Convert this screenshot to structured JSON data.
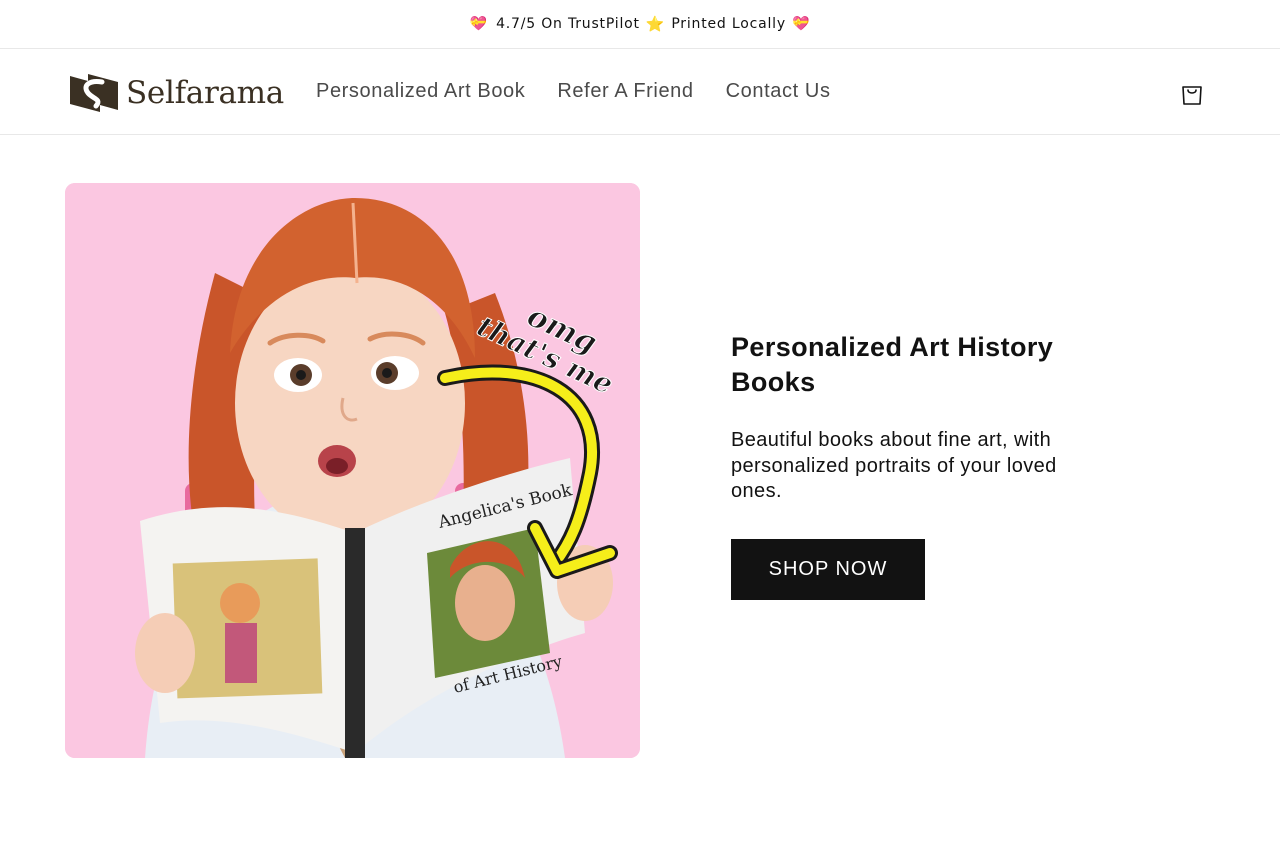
{
  "announcement": {
    "rating_text": "4.7/5 On TrustPilot",
    "printed_text": "Printed Locally",
    "heart_glyph": "💝",
    "star_glyph": "⭐"
  },
  "brand": {
    "name": "Selfarama",
    "logo_color": "#3a3023"
  },
  "nav": {
    "items": [
      {
        "label": "Personalized Art Book"
      },
      {
        "label": "Refer A Friend"
      },
      {
        "label": "Contact Us"
      }
    ]
  },
  "cart": {
    "icon": "shopping-bag-icon"
  },
  "hero": {
    "image": {
      "sticker_line1": "omg",
      "sticker_line2": "that's me",
      "book_title_top": "Angelica's Book",
      "book_title_bottom": "of Art History",
      "background_color": "#fbc7e1",
      "arrow_color": "#f5ee1a"
    },
    "title": "Personalized Art History Books",
    "subtitle": "Beautiful books about fine art, with personalized portraits of your loved ones.",
    "cta_label": "SHOP NOW"
  }
}
